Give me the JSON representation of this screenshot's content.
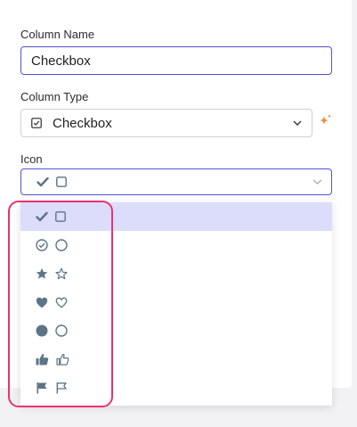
{
  "form": {
    "column_name_label": "Column Name",
    "column_name_value": "Checkbox",
    "column_type_label": "Column Type",
    "column_type_value": "Checkbox",
    "column_type_icon": "checkbox-square-icon",
    "icon_label": "Icon",
    "icon_selected": [
      "check-icon",
      "square-outline-icon"
    ],
    "ai_assist_icon": "sparkle-icon"
  },
  "icon_options": [
    {
      "checked": "check-icon",
      "unchecked": "square-outline-icon",
      "selected": true
    },
    {
      "checked": "check-circle-icon",
      "unchecked": "circle-outline-icon",
      "selected": false
    },
    {
      "checked": "star-filled-icon",
      "unchecked": "star-outline-icon",
      "selected": false
    },
    {
      "checked": "heart-filled-icon",
      "unchecked": "heart-outline-icon",
      "selected": false
    },
    {
      "checked": "circle-filled-icon",
      "unchecked": "circle-outline-icon",
      "selected": false
    },
    {
      "checked": "thumbs-up-filled-icon",
      "unchecked": "thumbs-up-outline-icon",
      "selected": false
    },
    {
      "checked": "flag-filled-icon",
      "unchecked": "flag-outline-icon",
      "selected": false
    }
  ],
  "colors": {
    "icon": "#5b7586",
    "accent": "#4f52d6",
    "selected_option_bg": "#dcdcfb",
    "highlight": "#e8336d",
    "sparkle": "#f08a3c"
  }
}
